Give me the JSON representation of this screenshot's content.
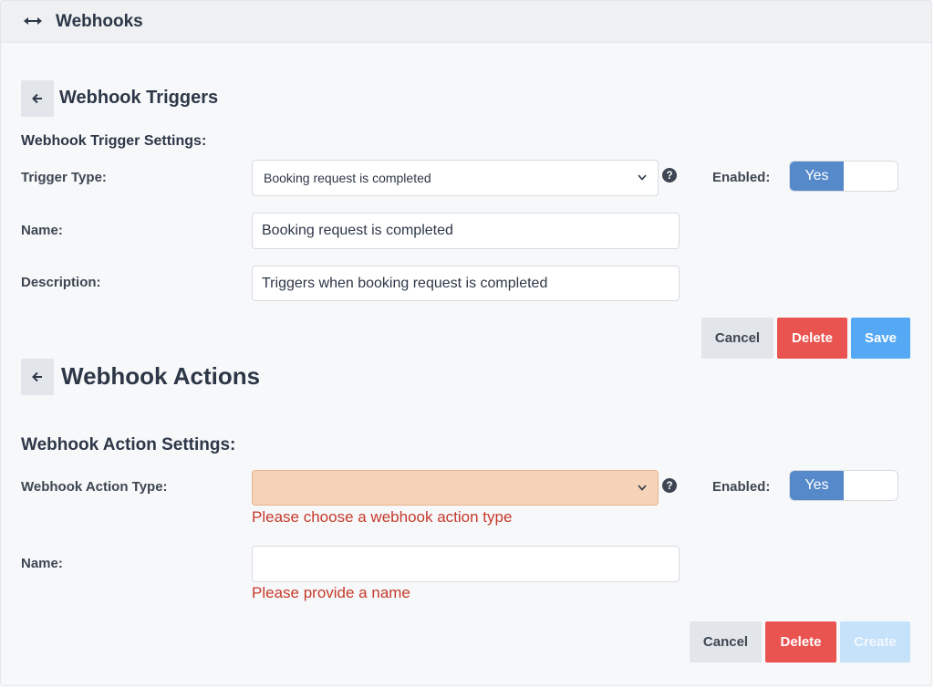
{
  "header": {
    "title": "Webhooks",
    "icon": "left-right-arrow-icon"
  },
  "triggers": {
    "heading": "Webhook Triggers",
    "settings_label": "Webhook Trigger Settings:",
    "trigger_type_label": "Trigger Type:",
    "trigger_type_value": "Booking request is completed",
    "enabled_label": "Enabled:",
    "enabled_value": "Yes",
    "name_label": "Name:",
    "name_value": "Booking request is completed",
    "description_label": "Description:",
    "description_value": "Triggers when booking request is completed",
    "cancel_label": "Cancel",
    "delete_label": "Delete",
    "save_label": "Save"
  },
  "actions": {
    "heading": "Webhook Actions",
    "settings_label": "Webhook Action Settings:",
    "action_type_label": "Webhook Action Type:",
    "action_type_value": "",
    "action_type_error": "Please choose a webhook action type",
    "enabled_label": "Enabled:",
    "enabled_value": "Yes",
    "name_label": "Name:",
    "name_value": "",
    "name_error": "Please provide a name",
    "cancel_label": "Cancel",
    "delete_label": "Delete",
    "create_label": "Create"
  },
  "colors": {
    "primary": "#55a8f3",
    "toggle_on": "#5589c9",
    "danger": "#ea5450",
    "error_text": "#c53a2c",
    "invalid_field": "#f5d3b8"
  }
}
